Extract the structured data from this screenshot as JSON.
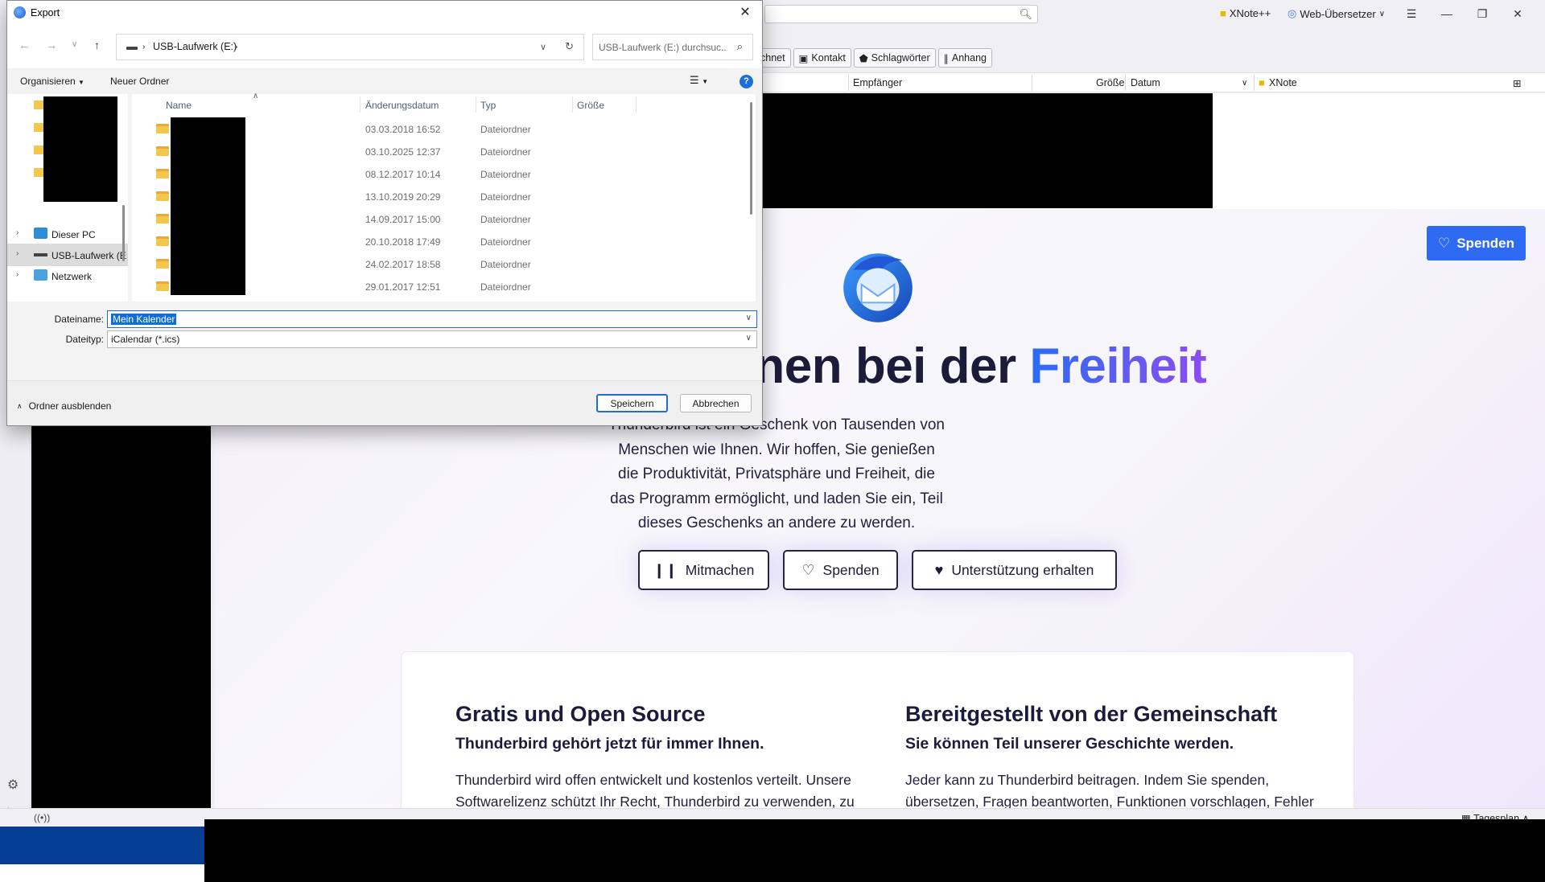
{
  "thunderbird": {
    "titlebar": {
      "xnote_addon": "XNote++",
      "translator_addon": "Web-Übersetzer"
    },
    "filter_buttons": [
      "chnet",
      "Kontakt",
      "Schlagwörter",
      "Anhang"
    ],
    "columns": {
      "recipient": "Empfänger",
      "size": "Größe",
      "date": "Datum",
      "xnote": "XNote"
    },
    "donate_top": "Spenden",
    "headline_prefix": "hnen bei der ",
    "headline_accent": "Freiheit",
    "intro": "Thunderbird ist ein Geschenk von Tausenden von Menschen wie Ihnen. Wir hoffen, Sie genießen die Produktivität, Privatsphäre und Freiheit, die das Programm ermöglicht, und laden Sie ein, Teil dieses Geschenks an andere zu werden.",
    "cta": {
      "join": "Mitmachen",
      "donate": "Spenden",
      "support": "Unterstützung erhalten"
    },
    "card": {
      "left_title": "Gratis und Open Source",
      "left_sub": "Thunderbird gehört jetzt für immer Ihnen.",
      "left_text": "Thunderbird wird offen entwickelt und kostenlos verteilt. Unsere Softwarelizenz schützt Ihr Recht, Thunderbird zu verwenden, zu",
      "right_title": "Bereitgestellt von der Gemeinschaft",
      "right_sub": "Sie können Teil unserer Geschichte werden.",
      "right_text": "Jeder kann zu Thunderbird beitragen. Indem Sie spenden, übersetzen, Fragen beantworten, Funktionen vorschlagen, Fehler"
    },
    "statusbar": {
      "tagesplan": "Tagesplan"
    }
  },
  "dialog": {
    "title": "Export",
    "address": {
      "drive": "USB-Laufwerk (E:)"
    },
    "search_placeholder": "USB-Laufwerk (E:) durchsuc...",
    "commands": {
      "organize": "Organisieren",
      "new_folder": "Neuer Ordner"
    },
    "nav": [
      {
        "label": "Dieser PC",
        "icon": "pc-icon"
      },
      {
        "label": "USB-Laufwerk (E:)",
        "icon": "usb-drive-icon",
        "selected": true
      },
      {
        "label": "Netzwerk",
        "icon": "network-icon"
      }
    ],
    "columns": {
      "name": "Name",
      "modified": "Änderungsdatum",
      "type": "Typ",
      "size": "Größe"
    },
    "files": [
      {
        "date": "03.03.2018 16:52",
        "type": "Dateiordner"
      },
      {
        "date": "03.10.2025 12:37",
        "type": "Dateiordner"
      },
      {
        "date": "08.12.2017 10:14",
        "type": "Dateiordner"
      },
      {
        "date": "13.10.2019 20:29",
        "type": "Dateiordner"
      },
      {
        "date": "14.09.2017 15:00",
        "type": "Dateiordner"
      },
      {
        "date": "20.10.2018 17:49",
        "type": "Dateiordner"
      },
      {
        "date": "24.02.2017 18:58",
        "type": "Dateiordner"
      },
      {
        "date": "29.01.2017 12:51",
        "type": "Dateiordner"
      }
    ],
    "filename_label": "Dateiname:",
    "filename_value": "Mein Kalender",
    "filetype_label": "Dateityp:",
    "filetype_value": "iCalendar (*.ics)",
    "hide_folders": "Ordner ausblenden",
    "save": "Speichern",
    "cancel": "Abbrechen"
  }
}
